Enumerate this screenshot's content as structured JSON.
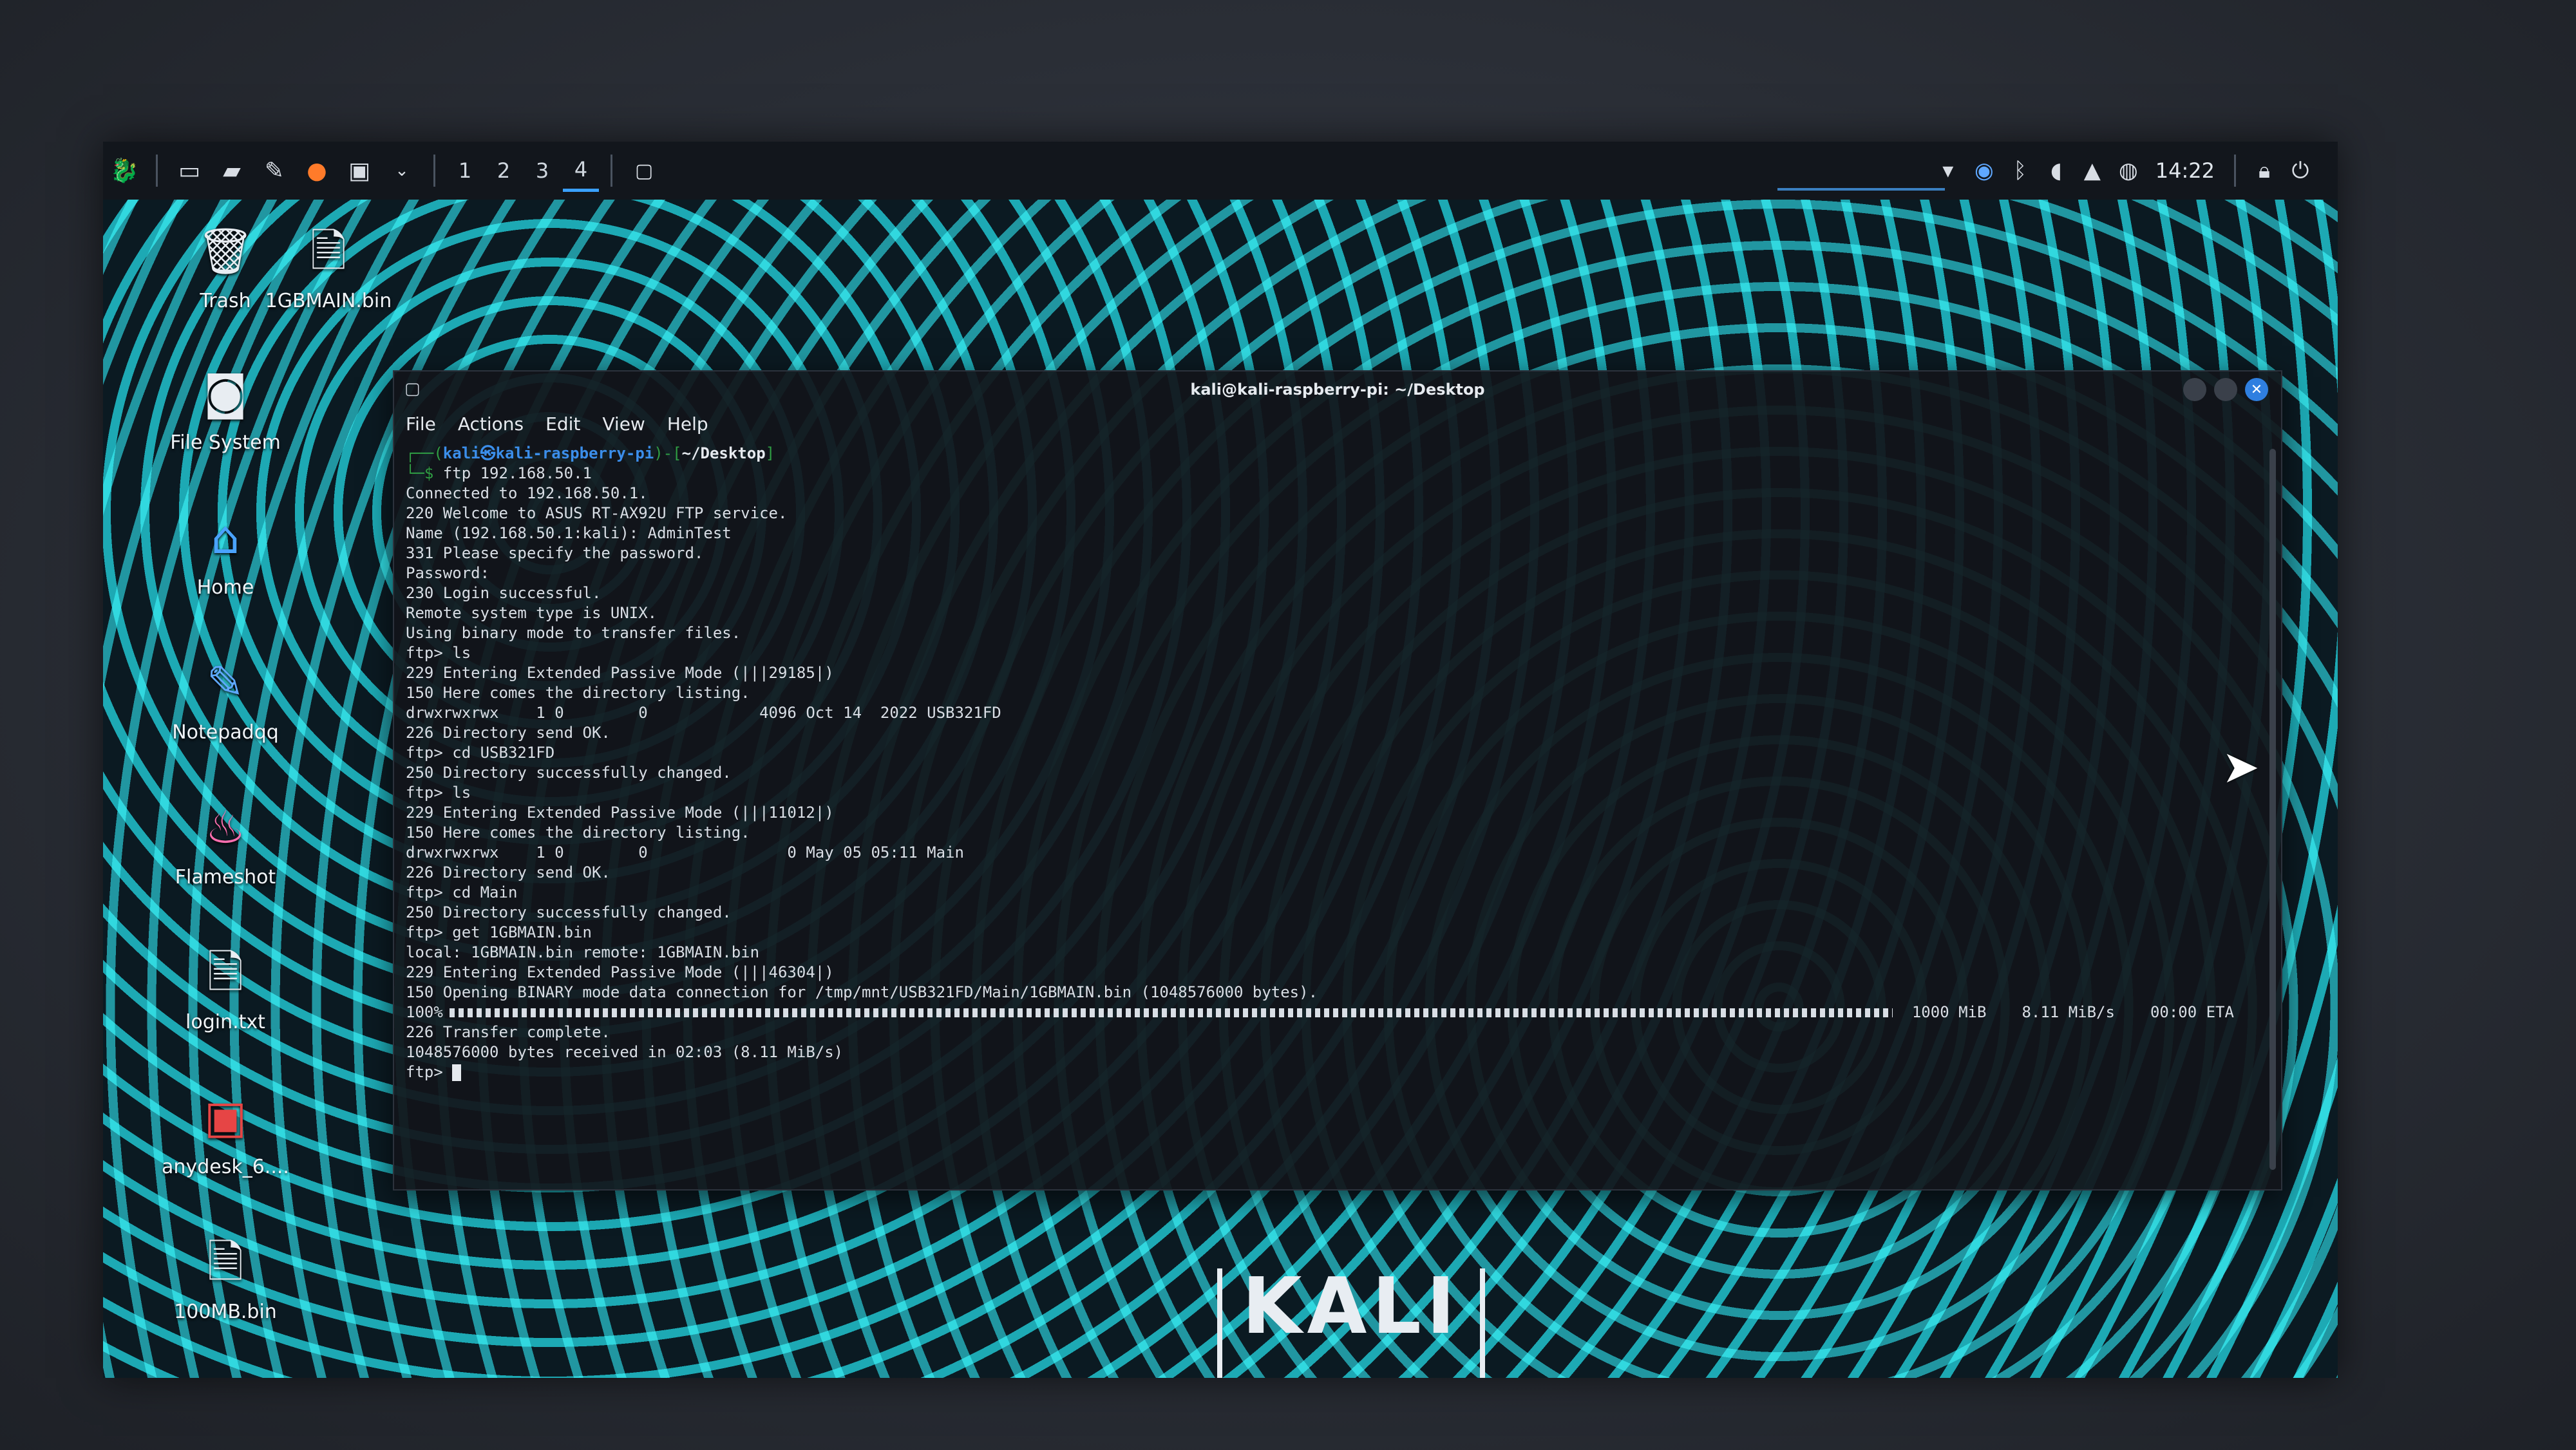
{
  "panel": {
    "workspaces": [
      "1",
      "2",
      "3",
      "4"
    ],
    "active_workspace": "4",
    "clock": "14:22",
    "icons": [
      "kali-menu-icon",
      "show-desktop-icon",
      "file-manager-icon",
      "text-editor-icon",
      "firefox-icon",
      "terminal-icon"
    ],
    "tray_icons": [
      "network-icon",
      "vpn-icon",
      "bluetooth-icon",
      "volume-icon",
      "notification-icon",
      "power-icon",
      "lock-icon",
      "logout-icon"
    ]
  },
  "desktop": {
    "icons": [
      {
        "label": "Trash",
        "icon": "trash-icon"
      },
      {
        "label": "1GBMAIN.bin",
        "icon": "file-icon"
      },
      {
        "label": "File System",
        "icon": "drive-icon"
      },
      {
        "label": "Home",
        "icon": "home-folder-icon"
      },
      {
        "label": "Notepadqq",
        "icon": "notepadqq-icon"
      },
      {
        "label": "Flameshot",
        "icon": "flameshot-icon"
      },
      {
        "label": "login.txt",
        "icon": "text-file-icon"
      },
      {
        "label": "anydesk_6....",
        "icon": "package-icon"
      },
      {
        "label": "100MB.bin",
        "icon": "file-icon"
      }
    ]
  },
  "terminal": {
    "title": "kali@kali-raspberry-pi: ~/Desktop",
    "menu": [
      "File",
      "Actions",
      "Edit",
      "View",
      "Help"
    ],
    "prompt_frame_top": "┌──(",
    "prompt_user": "kali㉿kali-raspberry-pi",
    "prompt_mid": ")-[",
    "prompt_dir": "~/Desktop",
    "prompt_end": "]",
    "prompt_frame_bottom": "└─$ ",
    "command": "ftp 192.168.50.1",
    "lines": [
      "Connected to 192.168.50.1.",
      "220 Welcome to ASUS RT-AX92U FTP service.",
      "Name (192.168.50.1:kali): AdminTest",
      "331 Please specify the password.",
      "Password:",
      "230 Login successful.",
      "Remote system type is UNIX.",
      "Using binary mode to transfer files.",
      "ftp> ls",
      "229 Entering Extended Passive Mode (|||29185|)",
      "150 Here comes the directory listing.",
      "drwxrwxrwx    1 0        0            4096 Oct 14  2022 USB321FD",
      "226 Directory send OK.",
      "ftp> cd USB321FD",
      "250 Directory successfully changed.",
      "ftp> ls",
      "229 Entering Extended Passive Mode (|||11012|)",
      "150 Here comes the directory listing.",
      "drwxrwxrwx    1 0        0               0 May 05 05:11 Main",
      "226 Directory send OK.",
      "ftp> cd Main",
      "250 Directory successfully changed.",
      "ftp> get 1GBMAIN.bin",
      "local: 1GBMAIN.bin remote: 1GBMAIN.bin",
      "229 Entering Extended Passive Mode (|||46304|)",
      "150 Opening BINARY mode data connection for /tmp/mnt/USB321FD/Main/1GBMAIN.bin (1048576000 bytes)."
    ],
    "progress": {
      "percent_label": "100%",
      "percent": 100,
      "size": "1000 MiB",
      "rate": "8.11 MiB/s",
      "eta": "00:00 ETA"
    },
    "after_lines": [
      "226 Transfer complete.",
      "1048576000 bytes received in 02:03 (8.11 MiB/s)"
    ],
    "final_prompt": "ftp> "
  },
  "wallpaper_logo": "KALI",
  "colors": {
    "accent": "#3aa0ff",
    "wallpaper_teal": "#1fb9c4",
    "terminal_bg": "#12141a"
  }
}
